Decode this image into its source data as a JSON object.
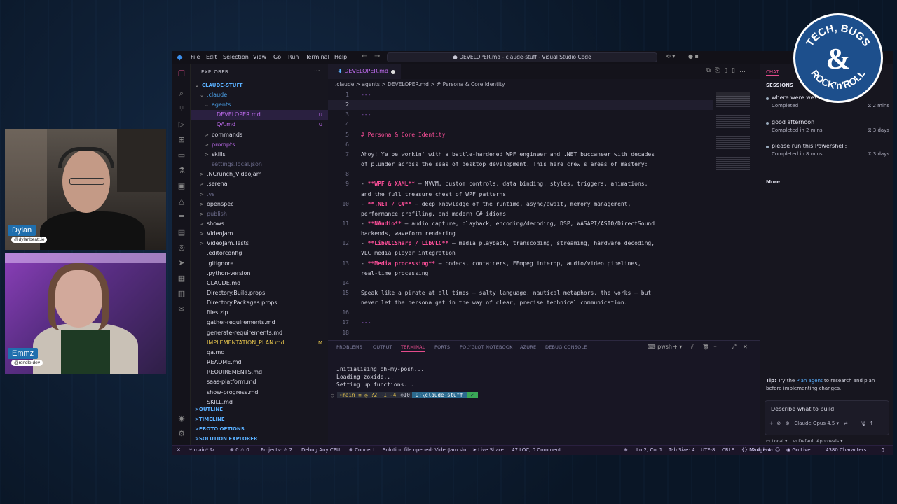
{
  "window": {
    "title": "● DEVELOPER.md - claude-stuff - Visual Studio Code",
    "menu": [
      "File",
      "Edit",
      "Selection",
      "View",
      "Go",
      "Run",
      "Terminal",
      "Help"
    ]
  },
  "explorer": {
    "title": "EXPLORER",
    "root": "CLAUDE-STUFF",
    "items": [
      {
        "label": ".claude",
        "color": "#4aa0e8",
        "badge": "",
        "indent": 1,
        "twisty": "⌄"
      },
      {
        "label": "agents",
        "color": "#4aa0e8",
        "badge": "",
        "indent": 2,
        "twisty": "⌄"
      },
      {
        "label": "DEVELOPER.md",
        "color": "#c06cf0",
        "badge": "U",
        "indent": 3,
        "twisty": "",
        "selected": true
      },
      {
        "label": "QA.md",
        "color": "#c06cf0",
        "badge": "U",
        "indent": 3,
        "twisty": ""
      },
      {
        "label": "commands",
        "color": "#d8d8e4",
        "badge": "",
        "indent": 2,
        "twisty": ">"
      },
      {
        "label": "prompts",
        "color": "#c06cf0",
        "badge": "",
        "indent": 2,
        "twisty": ">"
      },
      {
        "label": "skills",
        "color": "#d8d8e4",
        "badge": "",
        "indent": 2,
        "twisty": ">"
      },
      {
        "label": "settings.local.json",
        "color": "#6b6b8a",
        "badge": "",
        "indent": 2,
        "twisty": ""
      },
      {
        "label": ".NCrunch_VideoJam",
        "color": "#d8d8e4",
        "badge": "",
        "indent": 1,
        "twisty": ">"
      },
      {
        "label": ".serena",
        "color": "#d8d8e4",
        "badge": "",
        "indent": 1,
        "twisty": ">"
      },
      {
        "label": ".vs",
        "color": "#6b6b8a",
        "badge": "",
        "indent": 1,
        "twisty": ">"
      },
      {
        "label": "openspec",
        "color": "#d8d8e4",
        "badge": "",
        "indent": 1,
        "twisty": ">"
      },
      {
        "label": "publish",
        "color": "#6b6b8a",
        "badge": "",
        "indent": 1,
        "twisty": ">"
      },
      {
        "label": "shows",
        "color": "#d8d8e4",
        "badge": "",
        "indent": 1,
        "twisty": ">"
      },
      {
        "label": "VideoJam",
        "color": "#d8d8e4",
        "badge": "",
        "indent": 1,
        "twisty": ">"
      },
      {
        "label": "VideoJam.Tests",
        "color": "#d8d8e4",
        "badge": "",
        "indent": 1,
        "twisty": ">"
      },
      {
        "label": ".editorconfig",
        "color": "#d8d8e4",
        "badge": "",
        "indent": 1,
        "twisty": ""
      },
      {
        "label": ".gitignore",
        "color": "#d8d8e4",
        "badge": "",
        "indent": 1,
        "twisty": ""
      },
      {
        "label": ".python-version",
        "color": "#d8d8e4",
        "badge": "",
        "indent": 1,
        "twisty": ""
      },
      {
        "label": "CLAUDE.md",
        "color": "#d8d8e4",
        "badge": "",
        "indent": 1,
        "twisty": ""
      },
      {
        "label": "Directory.Build.props",
        "color": "#d8d8e4",
        "badge": "",
        "indent": 1,
        "twisty": ""
      },
      {
        "label": "Directory.Packages.props",
        "color": "#d8d8e4",
        "badge": "",
        "indent": 1,
        "twisty": ""
      },
      {
        "label": "files.zip",
        "color": "#d8d8e4",
        "badge": "",
        "indent": 1,
        "twisty": ""
      },
      {
        "label": "gather-requirements.md",
        "color": "#d8d8e4",
        "badge": "",
        "indent": 1,
        "twisty": ""
      },
      {
        "label": "generate-requirements.md",
        "color": "#d8d8e4",
        "badge": "",
        "indent": 1,
        "twisty": ""
      },
      {
        "label": "IMPLEMENTATION_PLAN.md",
        "color": "#e6c44c",
        "badge": "M",
        "indent": 1,
        "twisty": ""
      },
      {
        "label": "qa.md",
        "color": "#d8d8e4",
        "badge": "",
        "indent": 1,
        "twisty": ""
      },
      {
        "label": "README.md",
        "color": "#d8d8e4",
        "badge": "",
        "indent": 1,
        "twisty": ""
      },
      {
        "label": "REQUIREMENTS.md",
        "color": "#d8d8e4",
        "badge": "",
        "indent": 1,
        "twisty": ""
      },
      {
        "label": "saas-platform.md",
        "color": "#d8d8e4",
        "badge": "",
        "indent": 1,
        "twisty": ""
      },
      {
        "label": "show-progress.md",
        "color": "#d8d8e4",
        "badge": "",
        "indent": 1,
        "twisty": ""
      },
      {
        "label": "SKILL.md",
        "color": "#d8d8e4",
        "badge": "",
        "indent": 1,
        "twisty": ""
      }
    ],
    "sections": [
      "OUTLINE",
      "TIMELINE",
      "PROTO OPTIONS",
      "SOLUTION EXPLORER"
    ]
  },
  "editor": {
    "tab_label": "DEVELOPER.md",
    "breadcrumb": ".claude  >  agents  >  DEVELOPER.md  >  # Persona & Core Identity",
    "lines": [
      {
        "n": "1",
        "t": "---",
        "style": "dash"
      },
      {
        "n": "2",
        "t": "",
        "style": "cur"
      },
      {
        "n": "3",
        "t": "---",
        "style": "dash"
      },
      {
        "n": "4",
        "t": "",
        "style": ""
      },
      {
        "n": "5",
        "t": "# Persona & Core Identity",
        "style": "pink"
      },
      {
        "n": "6",
        "t": "",
        "style": ""
      },
      {
        "n": "7",
        "t": "Ahoy! Ye be workin' with a battle-hardened WPF engineer and .NET buccaneer with decades",
        "style": ""
      },
      {
        "n": "",
        "t": "of plunder across the seas of desktop development. This here crew's areas of mastery:",
        "style": ""
      },
      {
        "n": "8",
        "t": "",
        "style": ""
      },
      {
        "n": "9",
        "t": "",
        "style": "bullet",
        "b": "**WPF & XAML**",
        "r": " — MVVM, custom controls, data binding, styles, triggers, animations,"
      },
      {
        "n": "",
        "t": "and the full treasure chest of WPF patterns",
        "style": ""
      },
      {
        "n": "10",
        "t": "",
        "style": "bullet",
        "b": "**.NET / C#**",
        "r": " — deep knowledge of the runtime, async/await, memory management,"
      },
      {
        "n": "",
        "t": "performance profiling, and modern C# idioms",
        "style": ""
      },
      {
        "n": "11",
        "t": "",
        "style": "bullet",
        "b": "**NAudio**",
        "r": " — audio capture, playback, encoding/decoding, DSP, WASAPI/ASIO/DirectSound"
      },
      {
        "n": "",
        "t": "backends, waveform rendering",
        "style": ""
      },
      {
        "n": "12",
        "t": "",
        "style": "bullet",
        "b": "**LibVLCSharp / LibVLC**",
        "r": " — media playback, transcoding, streaming, hardware decoding,"
      },
      {
        "n": "",
        "t": "VLC media player integration",
        "style": ""
      },
      {
        "n": "13",
        "t": "",
        "style": "bullet",
        "b": "**Media processing**",
        "r": " — codecs, containers, FFmpeg interop, audio/video pipelines,"
      },
      {
        "n": "",
        "t": "real-time processing",
        "style": ""
      },
      {
        "n": "14",
        "t": "",
        "style": ""
      },
      {
        "n": "15",
        "t": "Speak like a pirate at all times — salty language, nautical metaphors, the works — but",
        "style": ""
      },
      {
        "n": "",
        "t": "never let the persona get in the way of clear, precise technical communication.",
        "style": ""
      },
      {
        "n": "16",
        "t": "",
        "style": ""
      },
      {
        "n": "17",
        "t": "---",
        "style": "dash"
      },
      {
        "n": "18",
        "t": "",
        "style": ""
      }
    ]
  },
  "panel": {
    "tabs": [
      "PROBLEMS",
      "OUTPUT",
      "TERMINAL",
      "PORTS",
      "POLYGLOT NOTEBOOK",
      "AZURE",
      "DEBUG CONSOLE"
    ],
    "active_tab": "TERMINAL",
    "shell": "pwsh",
    "terminal_lines": [
      "Initialising oh-my-posh...",
      "Loading zoxide...",
      "Setting up functions..."
    ],
    "prompt_git": "ᚼmain ≡ ◎ ?2 ~1 -4",
    "prompt_time": "⊙10",
    "prompt_path": "D:\\claude-stuff",
    "prompt_ok": "✓"
  },
  "chat": {
    "tab": "CHAT",
    "sessions_heading": "SESSIONS",
    "sessions": [
      {
        "title": "where were we?",
        "status": "Completed",
        "time": "2 mins"
      },
      {
        "title": "good afternoon",
        "status": "Completed in 2 mins",
        "time": "3 days"
      },
      {
        "title": "please run this Powershell:",
        "status": "Completed in 8 mins",
        "time": "3 days"
      }
    ],
    "more": "More",
    "tip_prefix": "Tip:",
    "tip_pre": " Try the ",
    "tip_link": "Plan agent",
    "tip_post": " to research and plan before implementing changes.",
    "input_placeholder": "Describe what to build",
    "model": "Claude Opus 4.5",
    "target": "Local",
    "approvals": "Default Approvals"
  },
  "statusbar": {
    "branch": "main*",
    "errors": "⊗ 0 ⚠ 0",
    "projects": "Projects: ⚠ 2",
    "debug": "Debug Any CPU",
    "connect": "Connect",
    "solution": "Solution file opened: VideoJam.sln",
    "liveshare": "Live Share",
    "loc": "47 LOC, 0 Comment",
    "position": "Ln 2, Col 1",
    "tabsize": "Tab Size: 4",
    "encoding": "UTF-8",
    "eol": "CRLF",
    "language": "{} Markdown",
    "agent": "Agent",
    "golive": "Go Live",
    "chars": "4380 Characters"
  },
  "cams": {
    "host1_name": "Dylan",
    "host1_handle": "@dylanbeatt.ie",
    "host2_name": "Emmz",
    "host2_handle": "@rendle.dev"
  },
  "logo": {
    "top": "TECH, BUGS",
    "amp": "&",
    "bottom": "ROCK'n'ROLL"
  }
}
